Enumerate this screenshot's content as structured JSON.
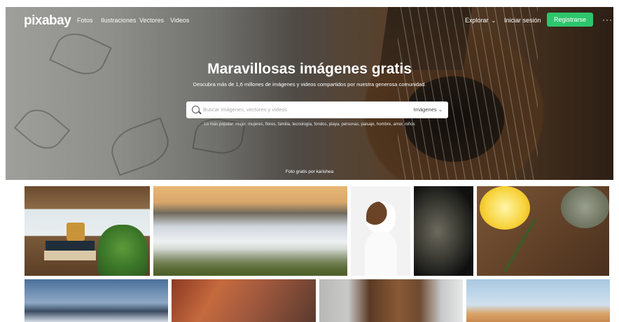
{
  "header": {
    "logo": "pixabay",
    "nav_links": [
      "Fotos",
      "Ilustraciones",
      "Vectores",
      "Videos"
    ],
    "explore_label": "Explorar",
    "login_label": "Iniciar sesión",
    "signup_label": "Registrarse",
    "more_label": "···"
  },
  "hero": {
    "title": "Maravillosas imágenes gratis",
    "subtitle": "Descubra más de 1,6 millones de imágenes y videos compartidos por nuestra generosa comunidad.",
    "search": {
      "placeholder": "Buscar imágenes, vectores y videos",
      "type_label": "Imágenes"
    },
    "popular_text": "Lo más popular: mujer, mujeres, flores, familia, tecnología, fondos, playa, personas, paisaje, hombre, amor, niños",
    "credit": "Foto gratis por karishea"
  },
  "gallery": {
    "row1": [
      "window-plant",
      "mountain-fog",
      "dog",
      "rhino",
      "lemon-rosemary"
    ],
    "row2": [
      "mountains-sky",
      "rooftops",
      "man-portrait",
      "desert-dunes"
    ]
  },
  "colors": {
    "accent": "#2ec66d"
  }
}
